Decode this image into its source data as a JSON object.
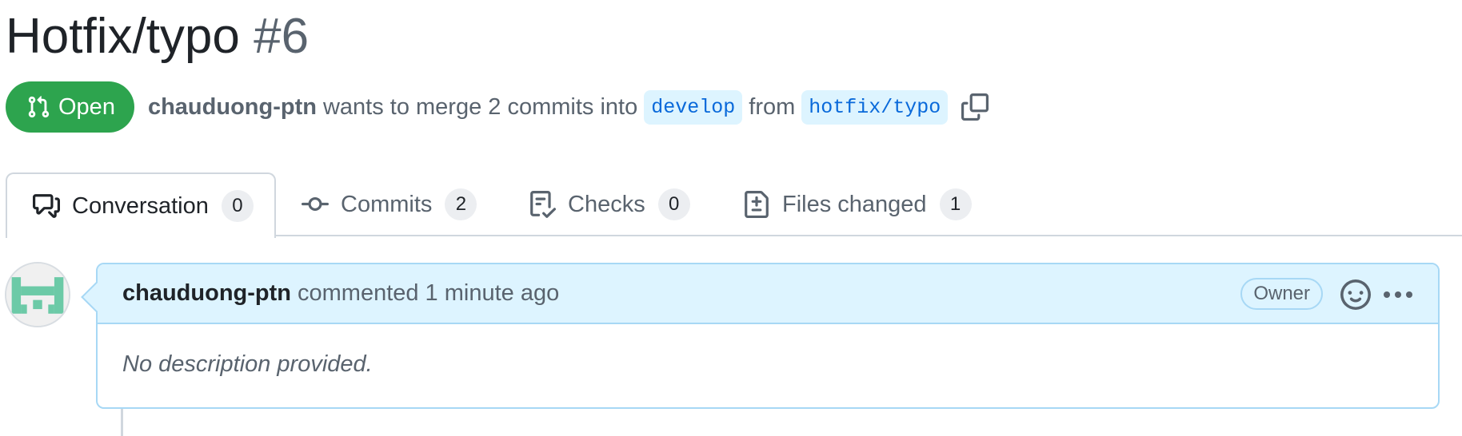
{
  "pr": {
    "title": "Hotfix/typo",
    "number": "#6",
    "state": "Open",
    "state_color": "#2da44e",
    "author": "chauduong-ptn",
    "merge_text": "wants to merge 2 commits into",
    "base_branch": "develop",
    "from_text": "from",
    "head_branch": "hotfix/typo",
    "copy_icon": "copy-icon"
  },
  "tabs": [
    {
      "label": "Conversation",
      "count": "0",
      "icon": "comment-discussion-icon",
      "selected": true
    },
    {
      "label": "Commits",
      "count": "2",
      "icon": "git-commit-icon",
      "selected": false
    },
    {
      "label": "Checks",
      "count": "0",
      "icon": "checklist-icon",
      "selected": false
    },
    {
      "label": "Files changed",
      "count": "1",
      "icon": "file-diff-icon",
      "selected": false
    }
  ],
  "comment": {
    "author": "chauduong-ptn",
    "action": "commented",
    "time": "1 minute ago",
    "badge": "Owner",
    "body": "No description provided.",
    "header_color": "#ddf4ff",
    "border_color": "#a7d8f5"
  }
}
